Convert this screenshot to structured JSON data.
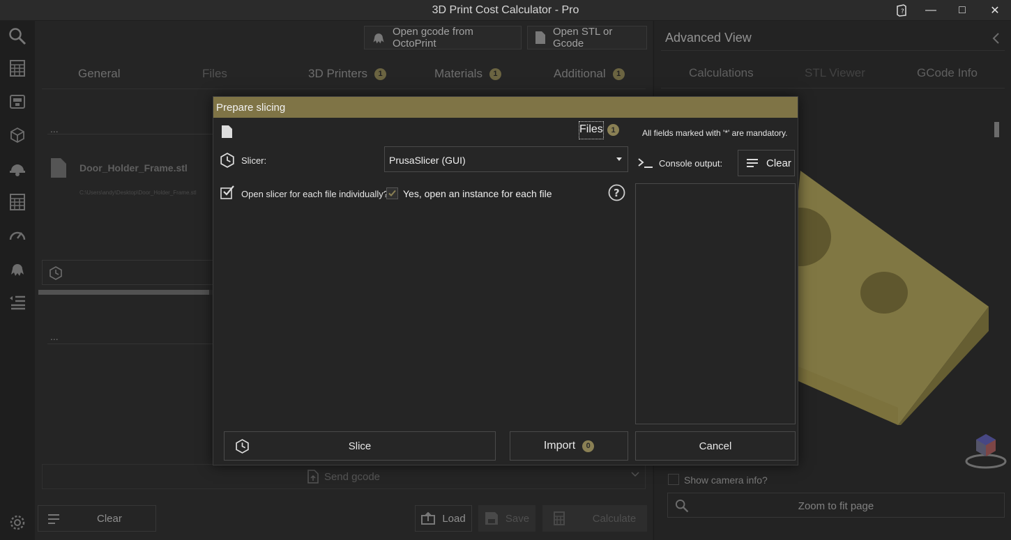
{
  "window": {
    "title": "3D Print Cost Calculator - Pro",
    "minimize": "—",
    "maximize": "□",
    "close": "✕"
  },
  "sidebar": {
    "items": [
      "search-icon",
      "calculator-icon",
      "printer-icon",
      "cube-icon",
      "worker-icon",
      "grid-calculator-icon",
      "gauge-icon",
      "octopus-icon",
      "list-icon"
    ],
    "settings": "settings-icon"
  },
  "main": {
    "top_buttons": {
      "octoprint": "Open gcode from OctoPrint",
      "open_stl": "Open STL or Gcode"
    },
    "tabs": [
      {
        "label": "General",
        "badge": ""
      },
      {
        "label": "Files",
        "badge": ""
      },
      {
        "label": "3D Printers",
        "badge": "1"
      },
      {
        "label": "Materials",
        "badge": "1"
      },
      {
        "label": "Additional",
        "badge": "1"
      }
    ],
    "section1_title": "...",
    "file": {
      "name": "Door_Holder_Frame.stl",
      "path": "C:\\Users\\andy\\Desktop\\Door_Holder_Frame.stl"
    },
    "section2_title": "...",
    "send_gcode": "Send gcode",
    "bottom": {
      "clear": "Clear",
      "load": "Load",
      "save": "Save",
      "calculate": "Calculate"
    }
  },
  "right_panel": {
    "title": "Advanced View",
    "tabs": [
      "Calculations",
      "STL Viewer",
      "GCode Info"
    ],
    "show_camera_info": "Show camera info?",
    "zoom_to_fit": "Zoom to fit page"
  },
  "dialog": {
    "title": "Prepare slicing",
    "files_label": "Files",
    "files_count": "1",
    "mandatory_note": "All fields marked with '*' are mandatory.",
    "slicer_label": "Slicer:",
    "slicer_value": "PrusaSlicer (GUI)",
    "open_each_label": "Open slicer for each file individually?",
    "open_each_value": "Yes, open an instance for each file",
    "open_each_checked": true,
    "console_label": "Console output:",
    "console_clear": "Clear",
    "slice_btn": "Slice",
    "import_btn": "Import",
    "import_count": "0",
    "cancel_btn": "Cancel"
  },
  "colors": {
    "accent": "#7f7446",
    "badge": "#8a8054",
    "model": "#b2a55b"
  }
}
